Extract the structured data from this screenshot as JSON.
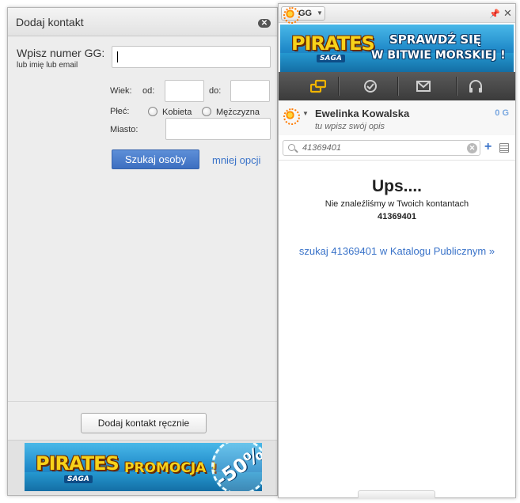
{
  "left_panel": {
    "title": "Dodaj kontakt",
    "gg_number_label": "Wpisz numer GG:",
    "gg_number_sublabel": "lub imię lub email",
    "gg_number_value": "",
    "age_label": "Wiek:",
    "age_from_label": "od:",
    "age_to_label": "do:",
    "gender_label": "Płeć:",
    "gender_options": [
      "Kobieta",
      "Mężczyzna"
    ],
    "city_label": "Miasto:",
    "search_button": "Szukaj osoby",
    "fewer_options_link": "mniej opcji",
    "add_manually_button": "Dodaj kontakt ręcznie",
    "banner": {
      "logo": "PIRATES",
      "logo_sub": "SAGA",
      "text": "PROMOCJA !",
      "badge": "-50%"
    }
  },
  "right_panel": {
    "menu_label": "GG",
    "banner": {
      "logo": "PIRATES",
      "logo_sub": "SAGA",
      "line1": "SPRAWDŹ SIĘ",
      "line2": "W BITWIE MORSKIEJ !"
    },
    "user": {
      "name": "Ewelinka Kowalska",
      "status_placeholder": "tu wpisz swój opis",
      "gg_balance": "0 G"
    },
    "search": {
      "value": "41369401"
    },
    "result": {
      "title": "Ups....",
      "message": "Nie znaleźliśmy w Twoich kontantach",
      "number": "41369401",
      "catalog_link": "szukaj 41369401 w Katalogu Publicznym »"
    }
  },
  "colors": {
    "accent": "#3a73c9",
    "button": "#4a7fcf",
    "toolbar": "#474747",
    "toolbar_active": "#f0b400"
  }
}
